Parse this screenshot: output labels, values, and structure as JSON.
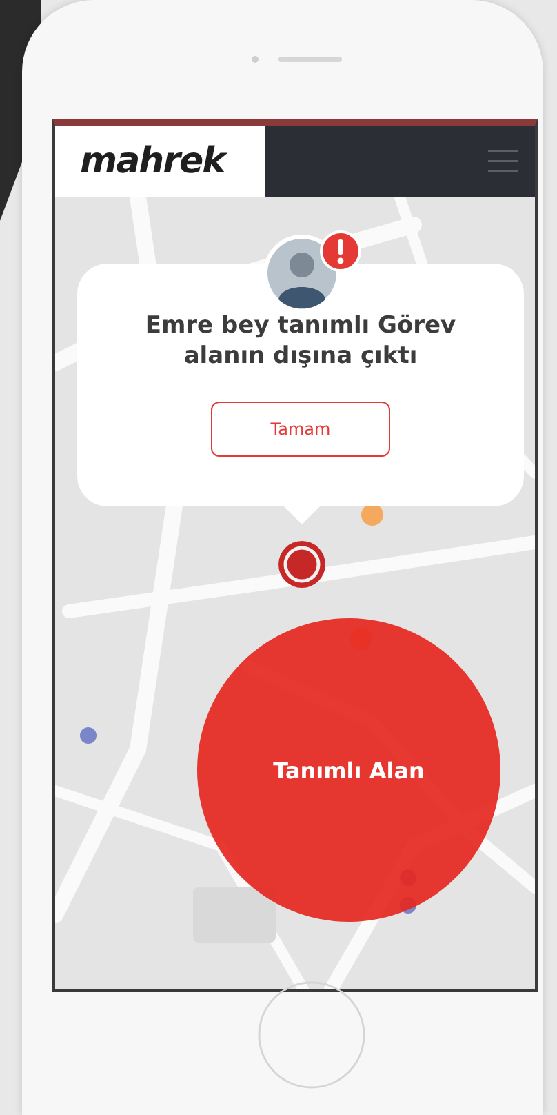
{
  "app": {
    "logo": "mahrek"
  },
  "alert": {
    "message": "Emre bey tanımlı Görev alanın dışına çıktı",
    "button": "Tamam"
  },
  "zone": {
    "label": "Tanımlı Alan"
  }
}
